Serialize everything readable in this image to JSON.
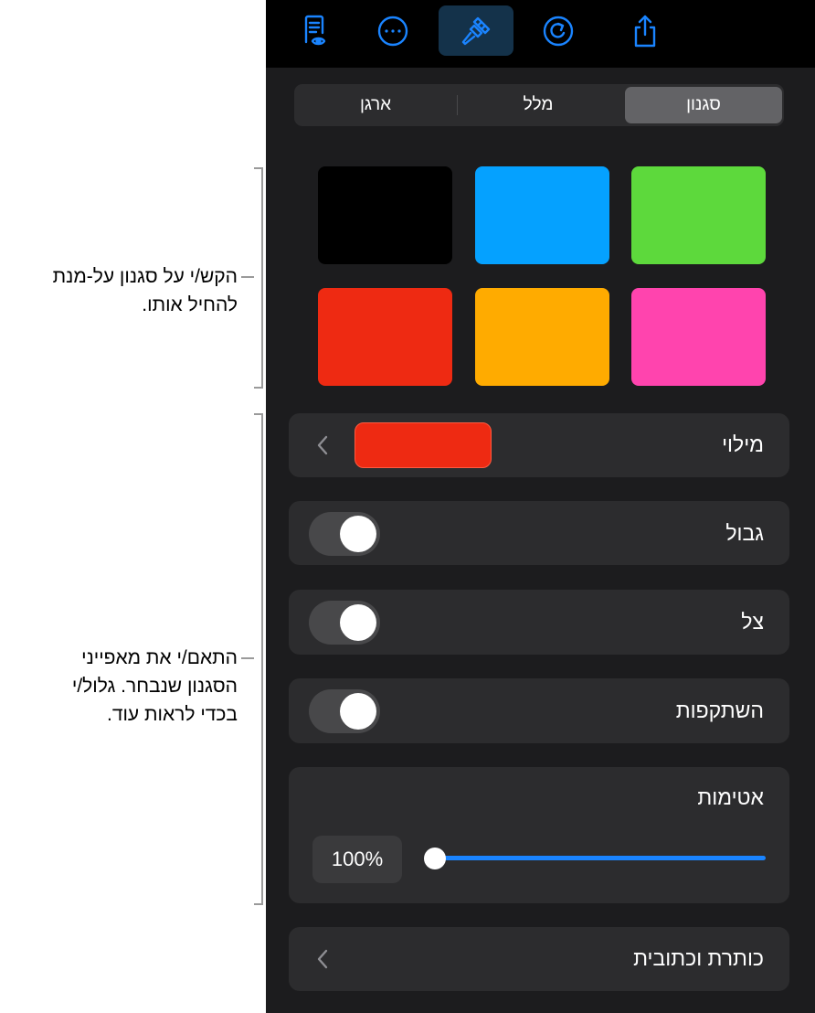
{
  "toolbar": {
    "icons": [
      "document-view-icon",
      "more-icon",
      "paintbrush-icon",
      "redo-icon",
      "share-icon"
    ],
    "accent": "#1a84ff",
    "active_bg": "#14324a"
  },
  "segmented": {
    "tabs": [
      "סגנון",
      "מלל",
      "ארגן"
    ],
    "selected": "סגנון"
  },
  "styles": {
    "swatches": [
      "#5dd93c",
      "#05a1ff",
      "#000000",
      "#ff44ae",
      "#ffab00",
      "#ee2a12"
    ]
  },
  "rows": {
    "fill": {
      "label": "מילוי",
      "color": "#ee2a12"
    },
    "border": {
      "label": "גבול",
      "on": false
    },
    "shadow": {
      "label": "צל",
      "on": false
    },
    "reflection": {
      "label": "השתקפות",
      "on": false
    },
    "opacity": {
      "label": "אטימות",
      "value": "100%"
    },
    "caption": {
      "label": "כותרת וכתובית"
    }
  },
  "callouts": {
    "top": [
      "הקש/י על סגנון על-מנת",
      "להחיל אותו."
    ],
    "bottom": [
      "התאם/י את מאפייני",
      "הסגנון שנבחר. גלול/י",
      "בכדי לראות עוד."
    ]
  }
}
